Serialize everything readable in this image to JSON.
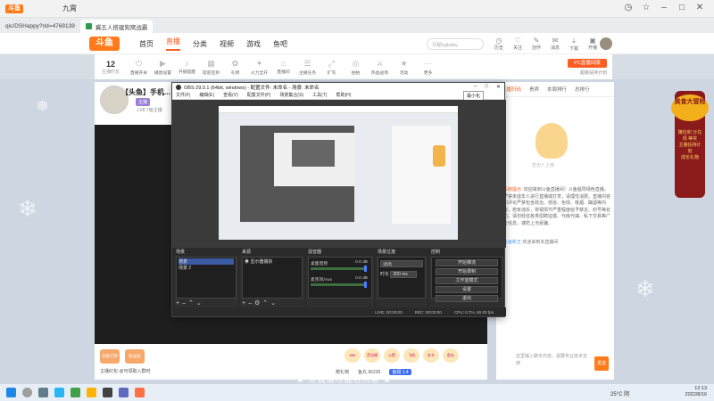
{
  "browser": {
    "url": "qic/DSHappy?rid=4768139",
    "tab_title_1": "九霄",
    "tab_title_2": "冀五人搭建狗窝战霸",
    "logo": "斗鱼"
  },
  "site": {
    "nav": [
      "首页",
      "直播",
      "分类",
      "视频",
      "游戏",
      "鱼吧"
    ],
    "search_placeholder": "日秘kgbaby",
    "header_icons": [
      "历史",
      "关注",
      "创作",
      "消息",
      "下载",
      "开播"
    ]
  },
  "catbar": {
    "count": "12",
    "count_label": "主播时长",
    "cats": [
      "直播开关",
      "播放设置",
      "开播提醒",
      "提前签到",
      "礼物",
      "火力全开",
      "直播间",
      "主播任务",
      "扩写",
      "拍拍",
      "热血战场",
      "活动",
      "更多"
    ],
    "pc_btn": "PC直播间版",
    "pc_btn_sub": "超级扶持计划"
  },
  "stream": {
    "title": "【头鱼】手机...",
    "tag": "主播",
    "level": "LV8 7级主播",
    "tags": [
      "关注",
      "VR直播"
    ]
  },
  "rightpanel": {
    "tabs": [
      "主播扫码",
      "贵宾",
      "本周排行",
      "总排行",
      "更多"
    ],
    "mascot_caption": "暂无人上榜",
    "sysmsg_label": "系统提示:",
    "sysmsg": "欢迎来到斗鱼直播间！斗鱼倡导绿色直播，严禁未成年人进行直播或打赏，请理性消费。直播内容和评论严禁包含政治、低俗、色情、吸烟、酗酒等内容，若有违反，将视情节严重程度给予禁言、封号等处罚。请勿轻信各类招聘征婚、代练代抽、私下交易等广告信息，谨防上当受骗。",
    "welcome_name": "斗鱼新王",
    "welcome_text": "欢迎来到本直播间",
    "chat_placeholder": "这里输入聊天内容，需要专业技术支持",
    "send": "发送"
  },
  "giftbar": {
    "badges": [
      "玩家打赏",
      "粉丝团"
    ],
    "fan_text": "主播红包 @可领取入群时",
    "gifts": [
      "666",
      "荧光棒",
      "火箭",
      "飞机",
      "办卡",
      "鱼丸"
    ],
    "stats": [
      "赠礼物",
      "鱼丸 96230",
      "鱼翅 1.4"
    ]
  },
  "ad": {
    "title": "美食大冒险",
    "text": "赚往积 分兑现 等奖",
    "sub": "主播扶持计划",
    "sub2": "成长礼物"
  },
  "bottom_text": "★ 点我填写报名问卷 ★",
  "obs": {
    "title": "OBS 29.0.1 (64bit, windows) - 配置文件: 未命名 - 场景: 未命名",
    "menu": [
      "文件(F)",
      "编辑(E)",
      "查看(V)",
      "配置文件(P)",
      "场景集合(S)",
      "工具(T)",
      "帮助(H)"
    ],
    "tooltip": "最小化",
    "scenes_header": "场景",
    "scenes": [
      "场景",
      "场景 2"
    ],
    "sources_header": "来源",
    "sources": [
      "显示器捕获"
    ],
    "mixer_header": "混音器",
    "mixer": [
      {
        "name": "桌面音频",
        "db": "0.0 dB"
      },
      {
        "name": "麦克风/Aux",
        "db": "0.0 dB"
      }
    ],
    "trans_header": "场景过渡",
    "trans_select": "淡出",
    "trans_duration_label": "时长",
    "trans_duration": "300 ms",
    "controls_header": "控制",
    "controls": [
      "开始推流",
      "开始录制",
      "工作室模式",
      "设置",
      "退出"
    ],
    "status": [
      "LIVE: 00:00:00",
      "REC: 00:00:00",
      "CPU: 0.7%, 60.00 fps"
    ],
    "progress_pct": 7
  },
  "taskbar": {
    "weather": "25°C 阴",
    "time": "12:13",
    "date": "2022/8/16"
  },
  "colors": {
    "accent": "#ff5d23",
    "obs_bg": "#2a2a2a"
  }
}
